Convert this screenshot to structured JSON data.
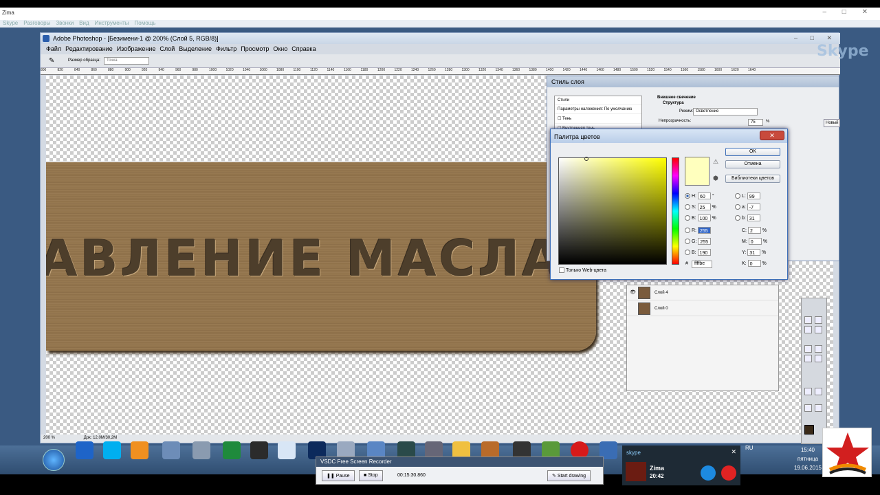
{
  "skype": {
    "window_title": "Zima",
    "menu": [
      "Skype",
      "Разговоры",
      "Звонки",
      "Вид",
      "Инструменты",
      "Помощь"
    ],
    "logo": "Skype"
  },
  "photoshop": {
    "title": "Adobe Photoshop - [Безимени-1 @ 200% (Слой 5, RGB/8)]",
    "menu": [
      "Файл",
      "Редактирование",
      "Изображение",
      "Слой",
      "Выделение",
      "Фильтр",
      "Просмотр",
      "Окно",
      "Справка"
    ],
    "options": {
      "sample_label": "Размер образца:",
      "sample_value": "Точка"
    },
    "ruler_ticks": [
      "800",
      "820",
      "840",
      "860",
      "880",
      "900",
      "920",
      "940",
      "960",
      "980",
      "1000",
      "1020",
      "1040",
      "1060",
      "1080",
      "1100",
      "1120",
      "1140",
      "1160",
      "1180",
      "1200",
      "1220",
      "1240",
      "1260",
      "1280",
      "1300",
      "1320",
      "1340",
      "1360",
      "1380",
      "1400",
      "1420",
      "1440",
      "1460",
      "1480",
      "1500",
      "1520",
      "1540",
      "1560",
      "1580",
      "1600",
      "1620",
      "1640"
    ],
    "canvas_text": "АВЛЕНИЕ  МАСЛА",
    "status": {
      "zoom": "200 %",
      "doc": "Док: 12,0M/30,2M"
    }
  },
  "layer_style": {
    "title": "Стиль слоя",
    "list": [
      "Стили",
      "Параметры наложения: По умолчанию",
      "Тень",
      "Внутренняя тень"
    ],
    "section": "Внешнее свечение",
    "subsection": "Структура",
    "mode_label": "Режим:",
    "mode_value": "Осветление",
    "opacity_label": "Непрозрачность:",
    "opacity_value": "75",
    "opacity_unit": "%",
    "side_button": "Новый"
  },
  "color_picker": {
    "title": "Палитра цветов",
    "ok": "OK",
    "cancel": "Отмена",
    "libraries": "Библиотеки цветов",
    "hsb": [
      {
        "k": "H:",
        "v": "60",
        "u": "°"
      },
      {
        "k": "S:",
        "v": "25",
        "u": "%"
      },
      {
        "k": "B:",
        "v": "100",
        "u": "%"
      }
    ],
    "rgb": [
      {
        "k": "R:",
        "v": "255"
      },
      {
        "k": "G:",
        "v": "255"
      },
      {
        "k": "B:",
        "v": "190"
      }
    ],
    "lab": [
      {
        "k": "L:",
        "v": "99"
      },
      {
        "k": "a:",
        "v": "-7"
      },
      {
        "k": "b:",
        "v": "31"
      }
    ],
    "cmyk": [
      {
        "k": "C:",
        "v": "2",
        "u": "%"
      },
      {
        "k": "M:",
        "v": "0",
        "u": "%"
      },
      {
        "k": "Y:",
        "v": "31",
        "u": "%"
      },
      {
        "k": "K:",
        "v": "0",
        "u": "%"
      }
    ],
    "hex": "ffffbe",
    "web_only": "Только Web-цвета",
    "new_color": "#ffffbe"
  },
  "layers": [
    {
      "name": "Слой 4"
    },
    {
      "name": "Слой 0"
    }
  ],
  "recorder": {
    "title": "VSDC Free Screen Recorder",
    "pause": "Pause",
    "stop": "Stop",
    "time": "00:15:30.860",
    "start_drawing": "Start drawing"
  },
  "skype_call": {
    "header": "skype",
    "name": "Zima",
    "duration": "20:42"
  },
  "tray": {
    "lang": "RU",
    "time": "15:40",
    "day": "пятница",
    "date": "19.06.2015"
  }
}
